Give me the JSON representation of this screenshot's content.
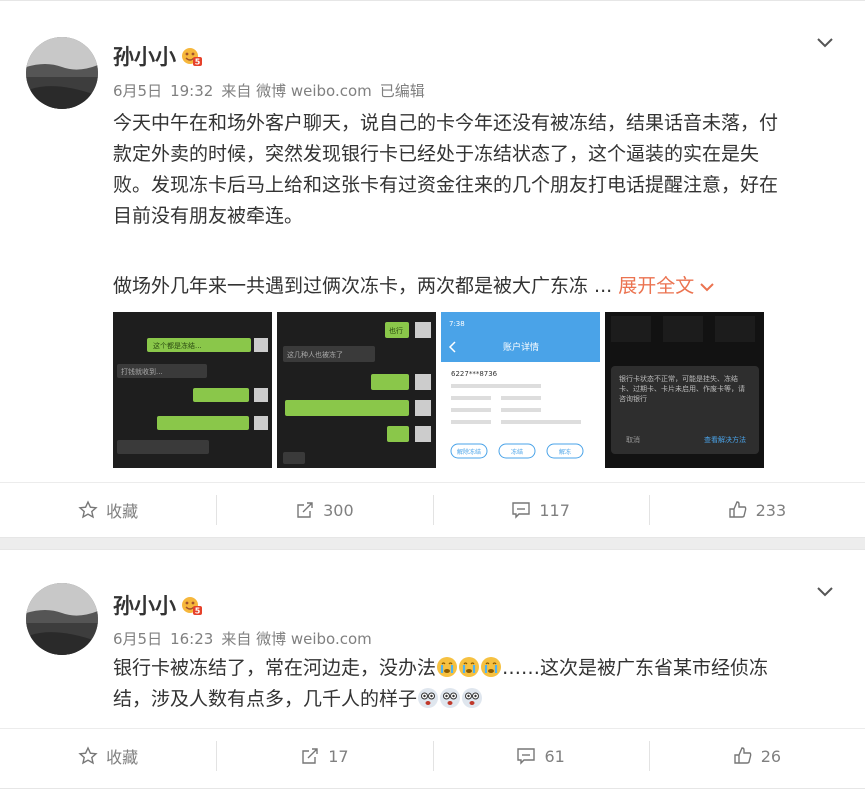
{
  "posts": [
    {
      "username": "孙小小",
      "date": "6月5日",
      "time": "19:32",
      "source": "来自 微博 weibo.com",
      "edited": "已编辑",
      "text_lines": [
        "今天中午在和场外客户聊天，说自己的卡今年还没有被冻结，结果话音未落，付",
        "款定外卖的时候，突然发现银行卡已经处于冻结状态了，这个逼装的实在是失",
        "败。发现冻卡后马上给和这张卡有过资金往来的几个朋友打电话提醒注意，好在",
        "目前没有朋友被牵连。"
      ],
      "text_tail": "做场外几年来一共遇到过俩次冻卡，两次都是被大广东冻 ...",
      "expand_label": "展开全文",
      "images": [
        {
          "kind": "chat-screenshot",
          "texts": [
            "这个都是冻结...",
            "打钱就收到..."
          ]
        },
        {
          "kind": "chat-screenshot",
          "texts": [
            "也行",
            "这几种人也被冻了"
          ]
        },
        {
          "kind": "account-detail",
          "title": "账户详情",
          "time": "7:38",
          "card_no": "6227***8736",
          "buttons": [
            "解除冻结",
            "冻结",
            "解冻"
          ]
        },
        {
          "kind": "dialog",
          "dialog_text": "银行卡状态不正常，可能是挂失、冻结卡、过期卡、卡片未启用、作废卡等，请咨询银行",
          "buttons": [
            "取消",
            "查看解决方法"
          ]
        }
      ],
      "actions": {
        "favorite": "收藏",
        "repost": "300",
        "comment": "117",
        "like": "233"
      }
    },
    {
      "username": "孙小小",
      "date": "6月5日",
      "time": "16:23",
      "source": "来自 微博 weibo.com",
      "text_line1_a": "银行卡被冻结了，常在河边走，没办法",
      "text_line1_b": "……这次是被广东省某市经侦冻",
      "text_line2": "结，涉及人数有点多，几千人的样子",
      "actions": {
        "favorite": "收藏",
        "repost": "17",
        "comment": "61",
        "like": "26"
      }
    }
  ],
  "colors": {
    "accent": "#eb7350",
    "meta": "#808080",
    "text": "#333333"
  },
  "icons": {
    "favorite": "star-icon",
    "repost": "share-icon",
    "comment": "comment-icon",
    "like": "thumbs-up-icon",
    "menu": "chevron-down-icon"
  }
}
